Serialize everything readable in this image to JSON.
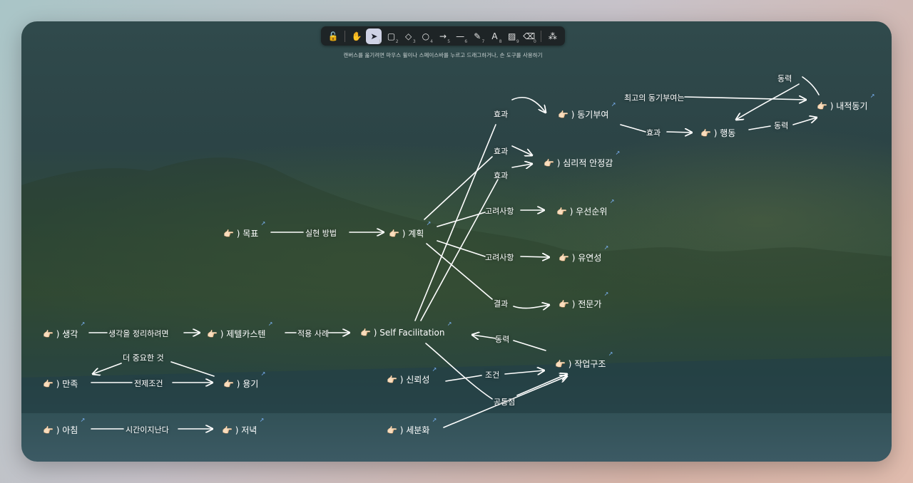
{
  "toolbar": {
    "tools": [
      {
        "name": "lock-icon",
        "glyph": "🔓",
        "num": ""
      },
      {
        "name": "hand-icon",
        "glyph": "✋",
        "num": ""
      },
      {
        "name": "pointer-icon",
        "glyph": "➤",
        "num": "1"
      },
      {
        "name": "rectangle-icon",
        "glyph": "▢",
        "num": "2"
      },
      {
        "name": "diamond-icon",
        "glyph": "◇",
        "num": "3"
      },
      {
        "name": "ellipse-icon",
        "glyph": "○",
        "num": "4"
      },
      {
        "name": "arrow-icon",
        "glyph": "→",
        "num": "5"
      },
      {
        "name": "line-icon",
        "glyph": "—",
        "num": "6"
      },
      {
        "name": "pencil-icon",
        "glyph": "✎",
        "num": "7"
      },
      {
        "name": "text-icon",
        "glyph": "A",
        "num": "8"
      },
      {
        "name": "image-icon",
        "glyph": "▨",
        "num": "9"
      },
      {
        "name": "eraser-icon",
        "glyph": "⌫",
        "num": "0"
      },
      {
        "name": "shapes-library-icon",
        "glyph": "⁂",
        "num": ""
      }
    ],
    "hint": "캔버스를 옮기려면 마우스 휠이나 스페이스바를 누르고 드래그하거나, 손 도구를 사용하기"
  },
  "nodes": {
    "motivation": "👉🏻 ) 동기부여",
    "emotional_safety": "👉🏻 ) 심리적 안정감",
    "action": "👉🏻 ) 행동",
    "intrinsic": "👉🏻 ) 내적동기",
    "goal": "👉🏻 ) 목표",
    "plan": "👉🏻 ) 계획",
    "priority": "👉🏻 ) 우선순위",
    "flexibility": "👉🏻 ) 유연성",
    "expert": "👉🏻 ) 전문가",
    "thought": "👉🏻 ) 생각",
    "zettelkasten": "👉🏻 ) 제텔카스텐",
    "self_facilitation": "👉🏻 ) Self Facilitation",
    "work_structure": "👉🏻 ) 작업구조",
    "satisfaction": "👉🏻 ) 만족",
    "courage": "👉🏻 ) 용기",
    "trust": "👉🏻 ) 신뢰성",
    "morning": "👉🏻 ) 아침",
    "evening": "👉🏻 ) 저녁",
    "detail": "👉🏻 ) 세분화"
  },
  "edge_labels": {
    "effect1": "효과",
    "effect2": "효과",
    "effect3": "효과",
    "effect4": "효과",
    "best_motivation": "최고의 동기부여는",
    "drive_top": "동력",
    "drive_right": "동력",
    "method": "실현 방법",
    "consider1": "고려사항",
    "consider2": "고려사항",
    "result": "결과",
    "organize": "생각을 정리하려면",
    "example": "적용 사례",
    "drive_mid": "동력",
    "more_important": "더 중요한 것",
    "precondition": "전제조건",
    "condition": "조건",
    "common": "공통점",
    "time_passes": "시간이지난다"
  },
  "colors": {
    "accent": "#cfd3e6",
    "link": "#7fb8ff",
    "ink": "#ffffff"
  }
}
